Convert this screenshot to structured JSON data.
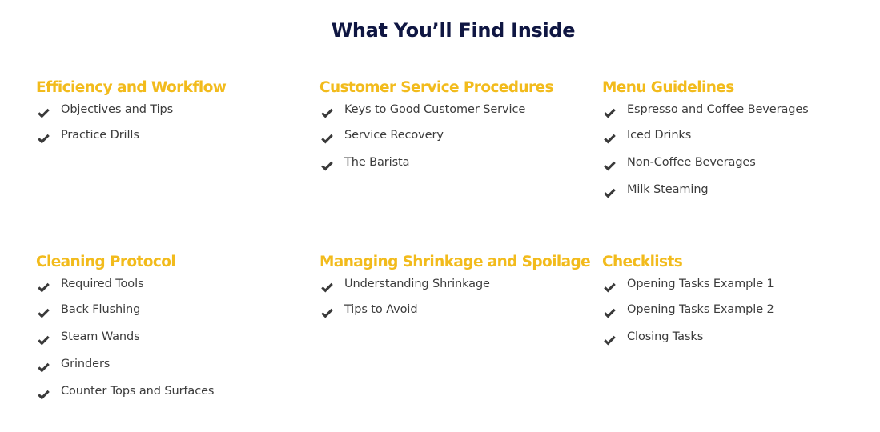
{
  "page": {
    "title": "What You’ll Find Inside"
  },
  "colors": {
    "title": "#0f1642",
    "section_heading": "#f2bb1c",
    "item_text": "#3c3c3c",
    "check_icon": "#3a3a3a"
  },
  "sections": [
    {
      "title": "Efficiency and Workflow",
      "icon": "check-icon",
      "items": [
        "Objectives and Tips",
        "Practice Drills"
      ]
    },
    {
      "title": "Customer Service Procedures",
      "icon": "check-icon",
      "items": [
        "Keys to Good Customer Service",
        "Service Recovery",
        "The Barista"
      ]
    },
    {
      "title": "Menu Guidelines",
      "icon": "check-icon",
      "items": [
        "Espresso and Coffee Beverages",
        "Iced Drinks",
        "Non-Coffee Beverages",
        "Milk Steaming"
      ]
    },
    {
      "title": "Cleaning Protocol",
      "icon": "check-icon",
      "items": [
        "Required Tools",
        "Back Flushing",
        "Steam Wands",
        "Grinders",
        "Counter Tops and Surfaces"
      ]
    },
    {
      "title": "Managing Shrinkage and Spoilage",
      "icon": "check-icon",
      "items": [
        "Understanding Shrinkage",
        "Tips to Avoid"
      ]
    },
    {
      "title": "Checklists",
      "icon": "check-icon",
      "items": [
        "Opening Tasks Example 1",
        "Opening Tasks Example 2",
        "Closing Tasks"
      ]
    }
  ]
}
